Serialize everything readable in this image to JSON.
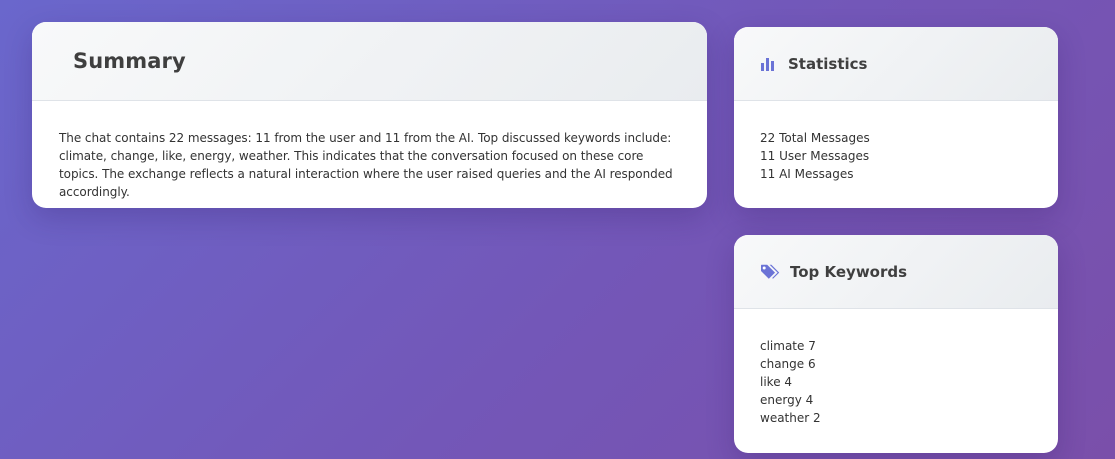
{
  "summary": {
    "title": "Summary",
    "text": "The chat contains 22 messages: 11 from the user and 11 from the AI. Top discussed keywords include: climate, change, like, energy, weather. This indicates that the conversation focused on these core topics. The exchange reflects a natural interaction where the user raised queries and the AI responded accordingly."
  },
  "statistics": {
    "title": "Statistics",
    "icon": "bar-chart-icon",
    "lines": [
      "22 Total Messages",
      "11 User Messages",
      "11 AI Messages"
    ]
  },
  "keywords": {
    "title": "Top Keywords",
    "icon": "tags-icon",
    "items": [
      {
        "word": "climate",
        "count": 7,
        "text": "climate 7"
      },
      {
        "word": "change",
        "count": 6,
        "text": "change 6"
      },
      {
        "word": "like",
        "count": 4,
        "text": "like 4"
      },
      {
        "word": "energy",
        "count": 4,
        "text": "energy 4"
      },
      {
        "word": "weather",
        "count": 2,
        "text": "weather 2"
      }
    ]
  },
  "colors": {
    "accent": "#6b73d6",
    "background_start": "#6a67cc",
    "background_end": "#7a4faa"
  }
}
